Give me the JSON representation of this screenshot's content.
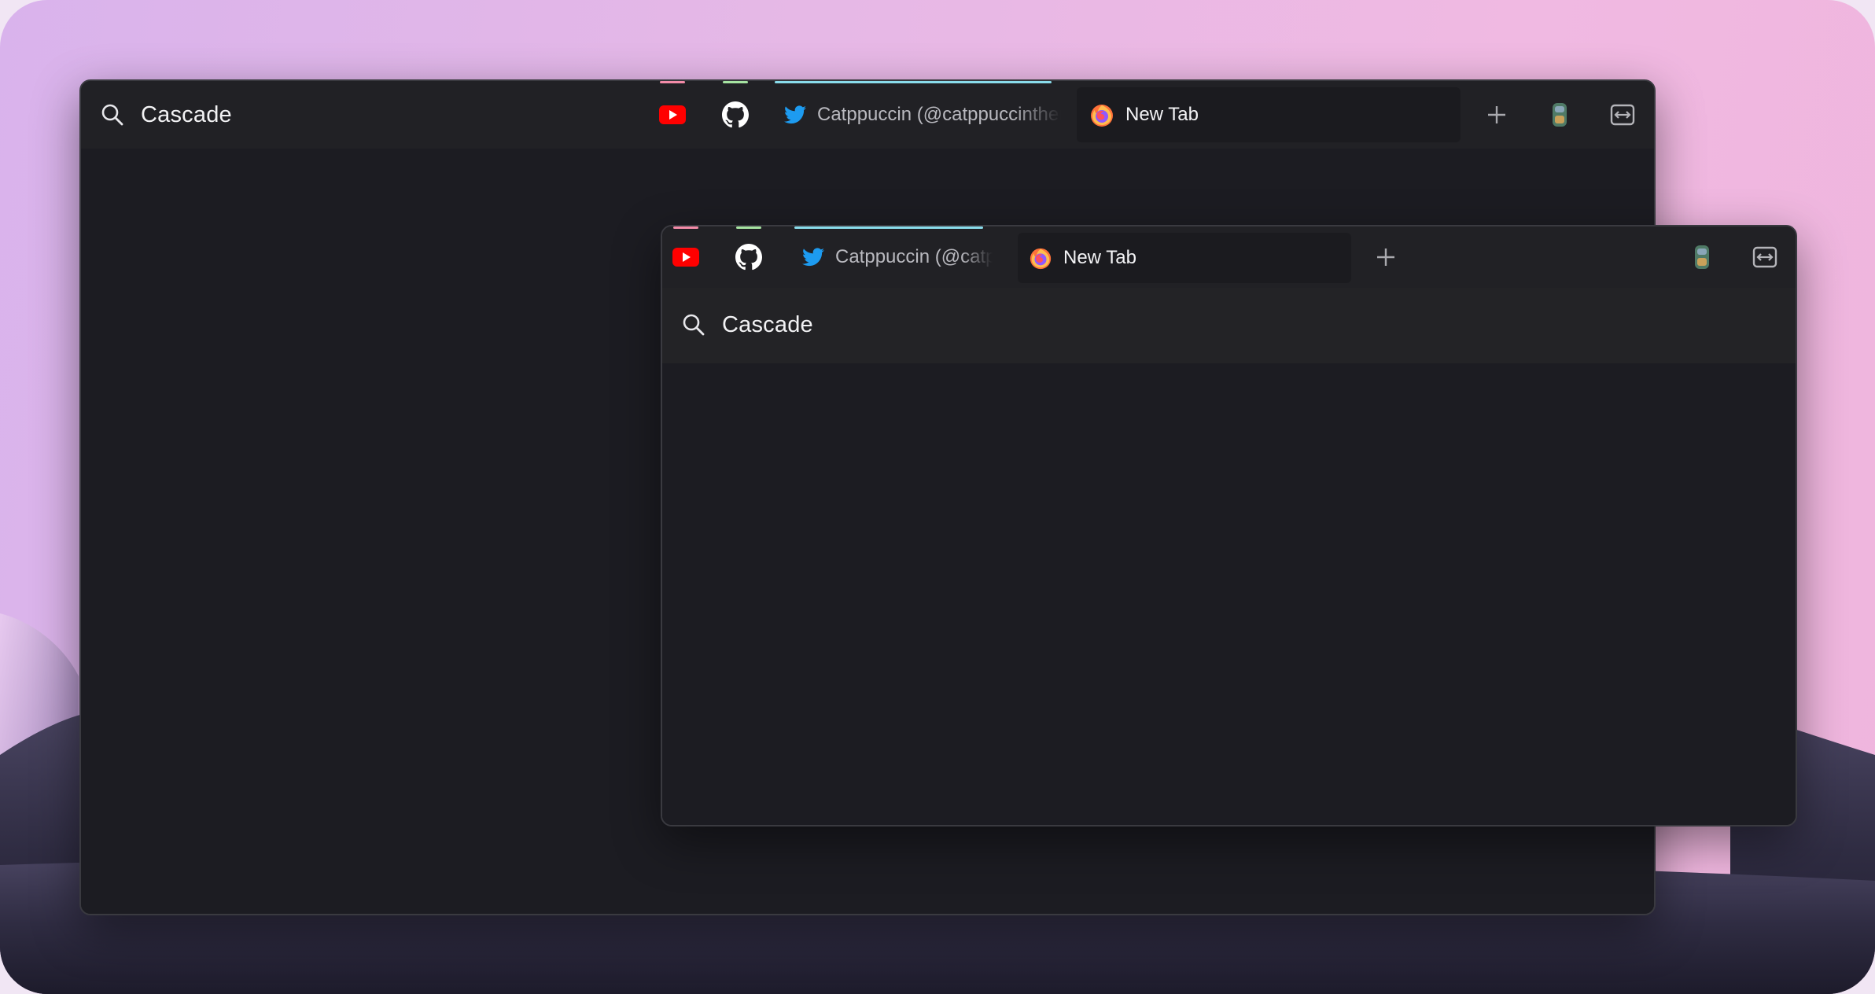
{
  "back_window": {
    "url_bar": {
      "text": "Cascade"
    },
    "tabs": [
      {
        "label": "",
        "site": "youtube",
        "accent": "#f38ba8"
      },
      {
        "label": "",
        "site": "github",
        "accent": "#a6e3a1"
      },
      {
        "label": "Catppuccin (@catppuccinther",
        "site": "twitter",
        "accent": "#89dceb"
      },
      {
        "label": "New Tab",
        "site": "firefox",
        "active": true
      }
    ],
    "toolbar_icons": [
      "plus-icon",
      "extension-icon",
      "sidebar-toggle-icon"
    ]
  },
  "front_window": {
    "tabs": [
      {
        "label": "",
        "site": "youtube",
        "accent": "#f38ba8"
      },
      {
        "label": "",
        "site": "github",
        "accent": "#a6e3a1"
      },
      {
        "label": "Catppuccin (@catp",
        "site": "twitter",
        "accent": "#89dceb"
      },
      {
        "label": "New Tab",
        "site": "firefox",
        "active": true
      }
    ],
    "url_bar": {
      "text": "Cascade"
    },
    "toolbar_icons": [
      "plus-icon",
      "extension-icon",
      "sidebar-toggle-icon"
    ]
  },
  "colors": {
    "window_bg": "#1c1c22",
    "toolbar_bg": "#212125",
    "youtube_red": "#ff0000",
    "twitter_blue": "#1d9bf0",
    "tab_accent_red": "#f38ba8",
    "tab_accent_green": "#a6e3a1",
    "tab_accent_cyan": "#89dceb"
  }
}
